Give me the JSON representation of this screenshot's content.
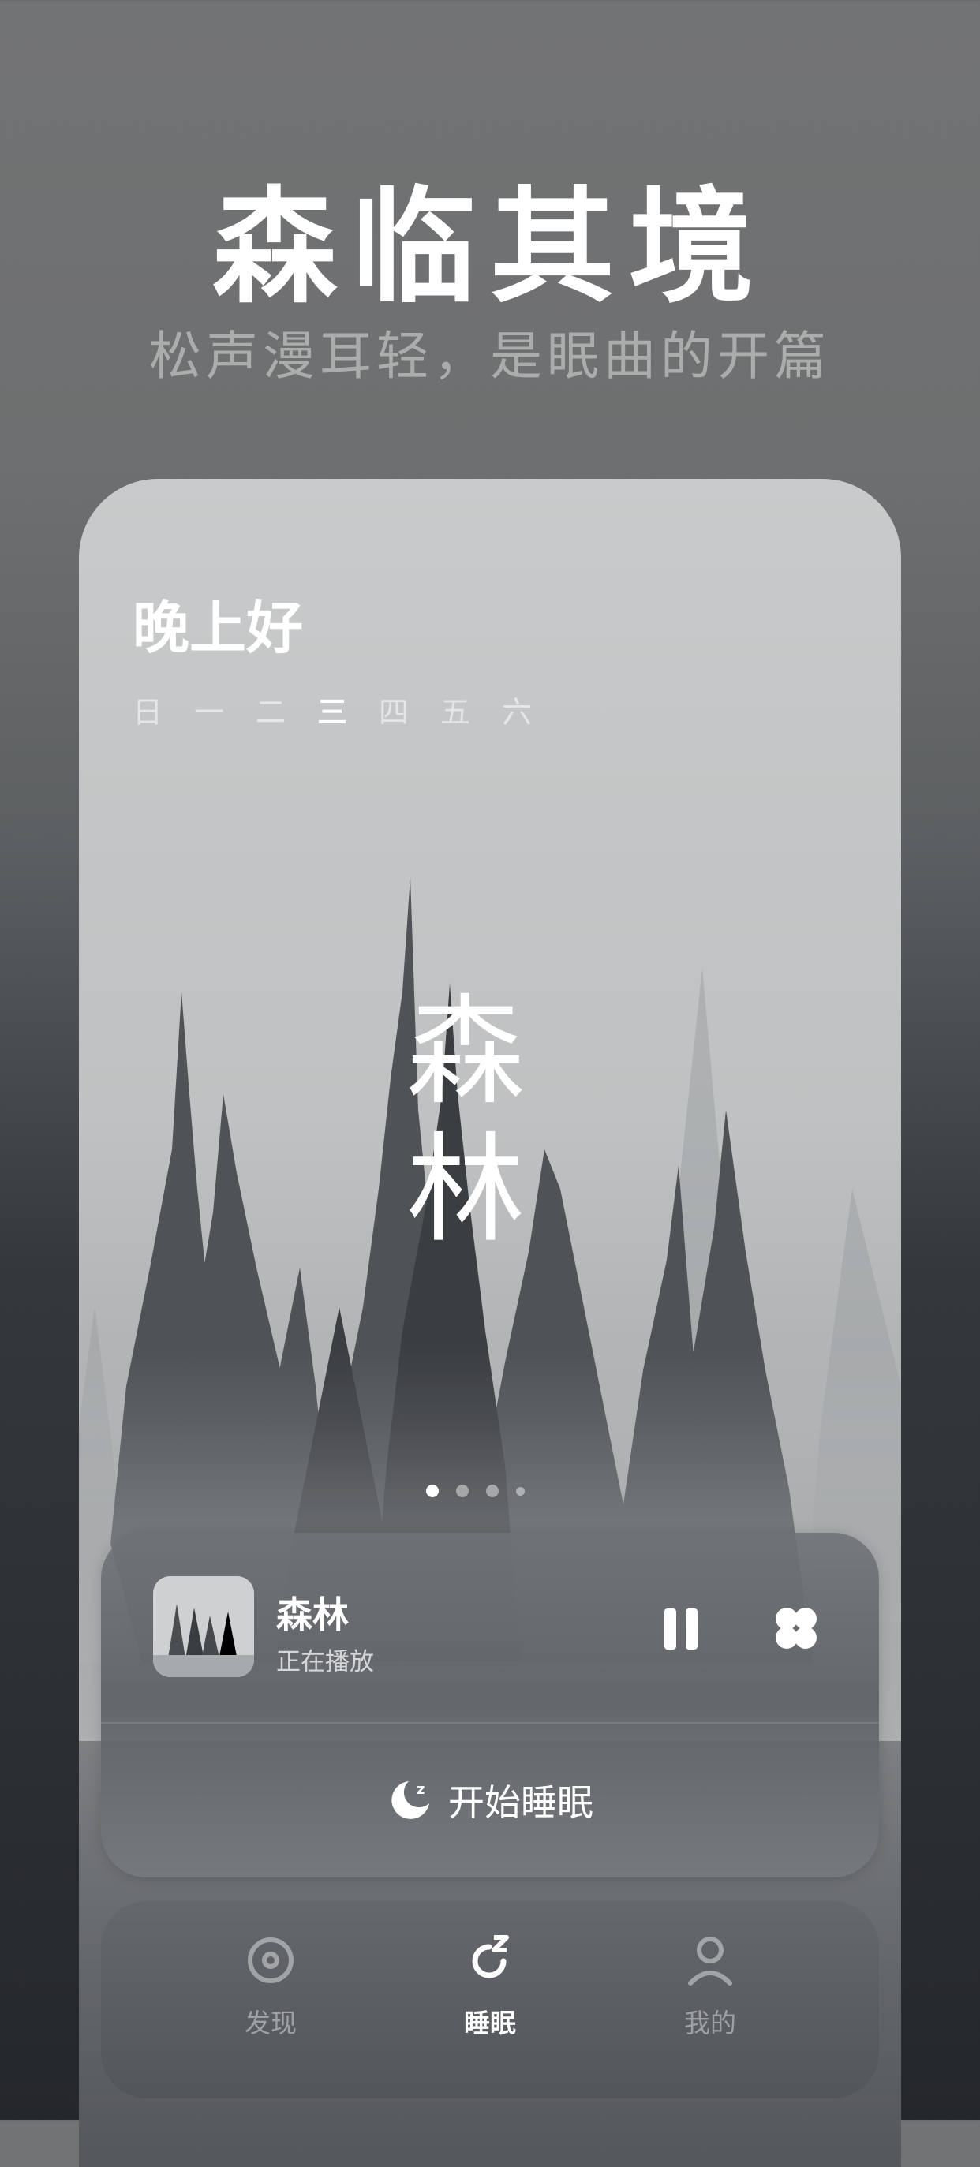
{
  "header": {
    "title": "森临其境",
    "subtitle": "松声漫耳轻，是眠曲的开篇"
  },
  "screen": {
    "greeting": "晚上好",
    "weekdays": [
      "日",
      "一",
      "二",
      "三",
      "四",
      "五",
      "六"
    ],
    "active_weekday_index": 3,
    "scene_title_chars": [
      "森",
      "林"
    ],
    "page_indicator": {
      "count": 4,
      "active_index": 0
    }
  },
  "player": {
    "cover_icon": "forest-thumbnail",
    "title": "森林",
    "status": "正在播放",
    "pause_icon": "pause-icon",
    "more_icon": "clover-icon",
    "sleep_icon": "moon-zz-icon",
    "sleep_label": "开始睡眠"
  },
  "tabbar": {
    "active_index": 1,
    "tabs": [
      {
        "label": "发现",
        "icon": "disc-icon"
      },
      {
        "label": "睡眠",
        "icon": "sleep-cycle-icon"
      },
      {
        "label": "我的",
        "icon": "person-icon"
      }
    ]
  },
  "colors": {
    "background_top": "#727374",
    "background_bottom": "#25282b",
    "text_primary": "#ffffff",
    "text_muted": "rgba(255,255,255,0.42)"
  }
}
